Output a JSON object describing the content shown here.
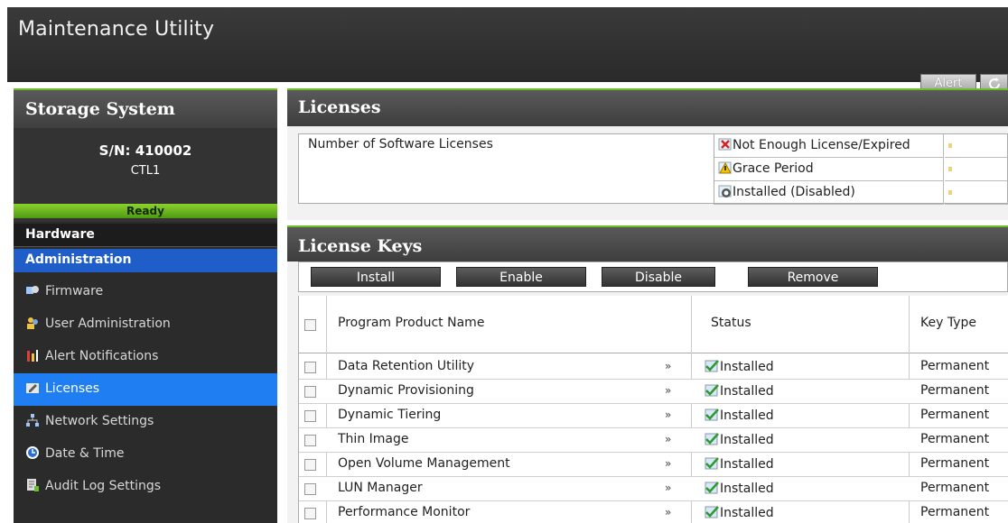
{
  "app": {
    "title": "Maintenance Utility",
    "alert_label": "Alert"
  },
  "sidebar": {
    "heading": "Storage System",
    "serial": "S/N: 410002",
    "controller": "CTL1",
    "status": "Ready",
    "sections": {
      "hardware": "Hardware",
      "administration": "Administration"
    },
    "items": [
      {
        "label": "Firmware",
        "icon": "firmware-icon"
      },
      {
        "label": "User Administration",
        "icon": "user-admin-icon"
      },
      {
        "label": "Alert Notifications",
        "icon": "alert-notifications-icon"
      },
      {
        "label": "Licenses",
        "icon": "licenses-icon",
        "active": true
      },
      {
        "label": "Network Settings",
        "icon": "network-icon"
      },
      {
        "label": "Date & Time",
        "icon": "clock-icon"
      },
      {
        "label": "Audit Log Settings",
        "icon": "audit-log-icon"
      }
    ]
  },
  "licenses": {
    "title": "Licenses",
    "count_label": "Number of Software Licenses",
    "legend": [
      {
        "label": "Not Enough License/Expired",
        "icon": "expired-icon"
      },
      {
        "label": "Grace Period",
        "icon": "warning-icon"
      },
      {
        "label": "Installed (Disabled)",
        "icon": "disabled-icon"
      }
    ]
  },
  "license_keys": {
    "title": "License Keys",
    "buttons": {
      "install": "Install",
      "enable": "Enable",
      "disable": "Disable",
      "remove": "Remove"
    },
    "columns": {
      "name": "Program Product Name",
      "status": "Status",
      "key_type": "Key Type"
    },
    "rows": [
      {
        "name": "Data Retention Utility",
        "status": "Installed",
        "key_type": "Permanent"
      },
      {
        "name": "Dynamic Provisioning",
        "status": "Installed",
        "key_type": "Permanent"
      },
      {
        "name": "Dynamic Tiering",
        "status": "Installed",
        "key_type": "Permanent"
      },
      {
        "name": "Thin Image",
        "status": "Installed",
        "key_type": "Permanent"
      },
      {
        "name": "Open Volume Management",
        "status": "Installed",
        "key_type": "Permanent"
      },
      {
        "name": "LUN Manager",
        "status": "Installed",
        "key_type": "Permanent"
      },
      {
        "name": "Performance Monitor",
        "status": "Installed",
        "key_type": "Permanent"
      }
    ]
  },
  "colors": {
    "accent_green": "#6bbf2a",
    "nav_blue": "#1f7ef2",
    "admin_blue": "#1f5ec8"
  }
}
